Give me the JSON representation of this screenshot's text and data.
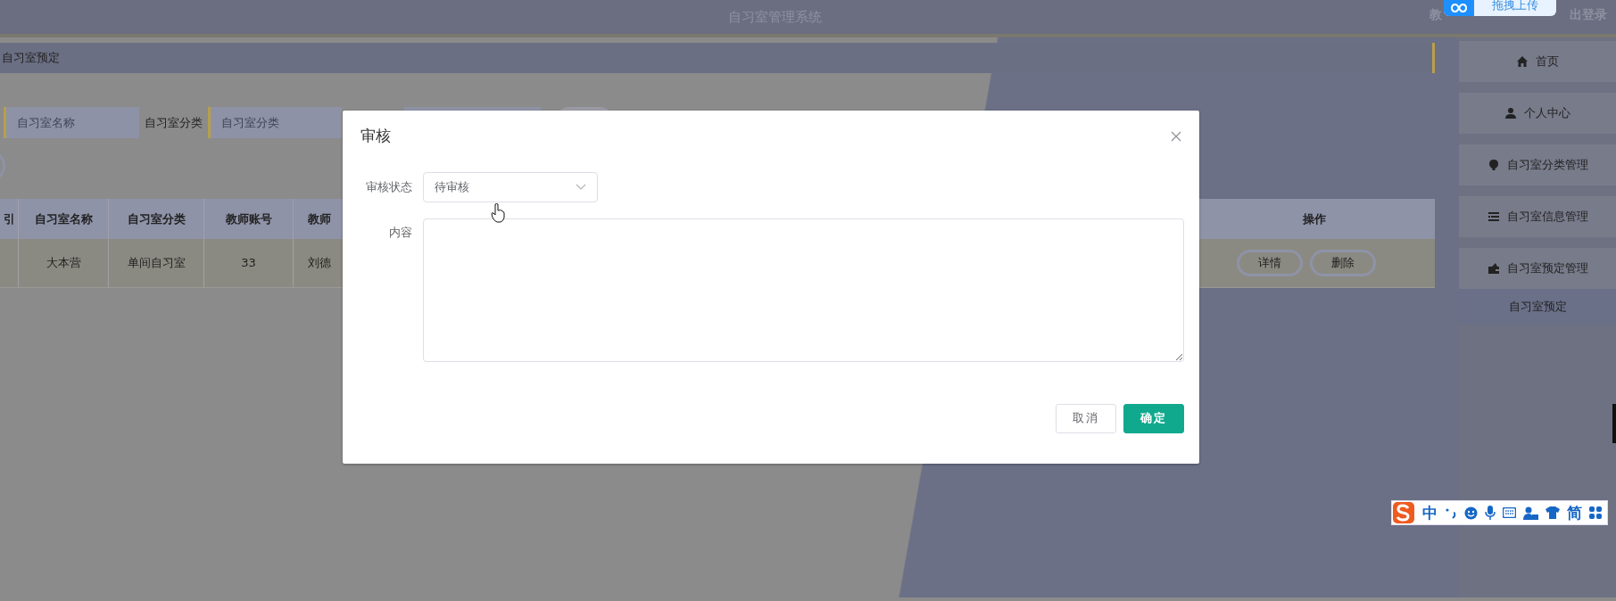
{
  "header": {
    "title": "自习室管理系统",
    "user_text": "教",
    "logout_text": "出登录"
  },
  "upload_widget": {
    "label": "拖拽上传"
  },
  "breadcrumb": "自习室预定",
  "search": {
    "fields": [
      {
        "placeholder": "自习室名称"
      },
      {
        "label": "自习室分类",
        "placeholder": "自习室分类"
      }
    ]
  },
  "table": {
    "columns": [
      "引",
      "自习室名称",
      "自习室分类",
      "教师账号",
      "教师",
      "操作"
    ],
    "rows": [
      {
        "cells": [
          "",
          "大本营",
          "单间自习室",
          "33",
          "刘德"
        ],
        "actions": [
          "详情",
          "删除"
        ]
      }
    ]
  },
  "sidebar": {
    "items": [
      {
        "label": "首页"
      },
      {
        "label": "个人中心"
      },
      {
        "label": "自习室分类管理"
      },
      {
        "label": "自习室信息管理"
      },
      {
        "label": "自习室预定管理",
        "children": [
          {
            "label": "自习室预定",
            "selected": true
          }
        ]
      }
    ]
  },
  "dialog": {
    "title": "审核",
    "status_field": {
      "label": "审核状态",
      "value": "待审核"
    },
    "content_field": {
      "label": "内容"
    },
    "buttons": [
      {
        "label": "取消",
        "kind": "secondary"
      },
      {
        "label": "确定",
        "kind": "primary"
      }
    ]
  },
  "ime_toolbar": {
    "mode": "中",
    "script": "简"
  }
}
